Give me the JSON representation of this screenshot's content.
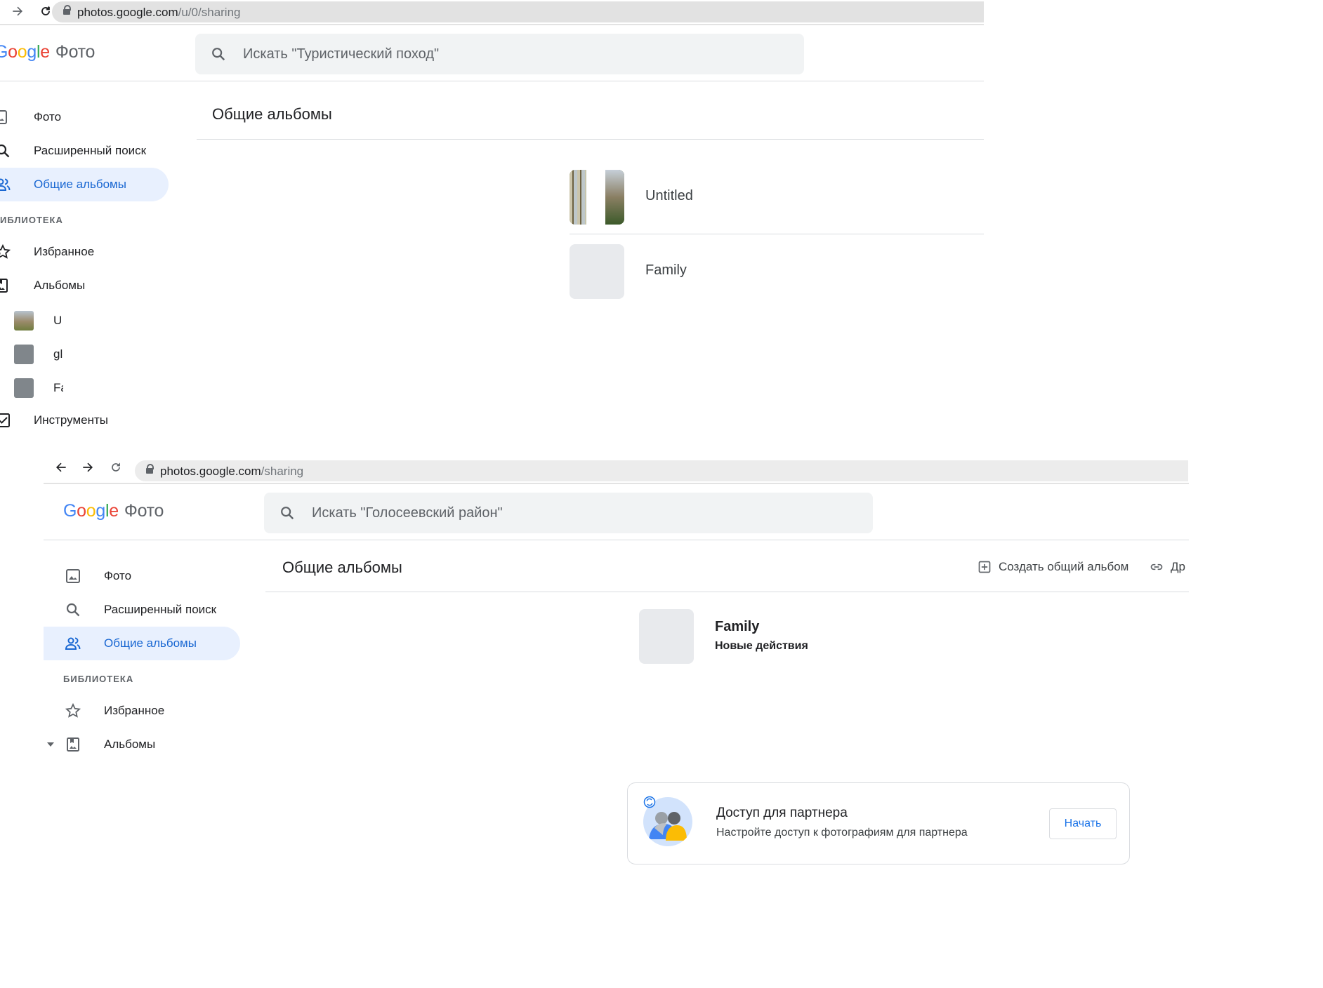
{
  "shot1": {
    "url_host": "photos.google.com",
    "url_path": "/u/0/sharing",
    "logo_text": "oogle",
    "logo_product": "Фото",
    "search_placeholder": "Искать \"Туристический поход\"",
    "nav": {
      "photos": "Фото",
      "explore": "Расширенный поиск",
      "sharing": "Общие альбомы",
      "library_label": "ИБЛИОТЕКА",
      "favorites": "Избранное",
      "albums": "Альбомы",
      "sub_albums": [
        "U",
        "gl",
        "Fa"
      ],
      "utilities": "Инструменты"
    },
    "page_title": "Общие альбомы",
    "albums": [
      {
        "title": "Untitled"
      },
      {
        "title": "Family"
      }
    ]
  },
  "shot2": {
    "url_host": "photos.google.com",
    "url_path": "/sharing",
    "logo_parts": [
      "G",
      "o",
      "o",
      "g",
      "l",
      "e"
    ],
    "logo_product": "Фото",
    "search_placeholder": "Искать \"Голосеевский район\"",
    "nav": {
      "photos": "Фото",
      "explore": "Расширенный поиск",
      "sharing": "Общие альбомы",
      "library_label": "БИБЛИОТЕКА",
      "favorites": "Избранное",
      "albums": "Альбомы"
    },
    "page_title": "Общие альбомы",
    "actions": {
      "create": "Создать общий альбом",
      "link": "Др"
    },
    "album": {
      "title": "Family",
      "subtitle": "Новые действия"
    },
    "partner": {
      "title": "Доступ для партнера",
      "description": "Настройте доступ к фотографиям для партнера",
      "button": "Начать"
    }
  },
  "colors": {
    "active_nav_bg": "#e8f0fe",
    "active_nav_text": "#1967d2",
    "accent": "#1a73e8"
  },
  "icons": [
    "back-icon",
    "forward-icon",
    "reload-icon",
    "lock-icon",
    "search-icon",
    "photo-icon",
    "sharing-icon",
    "star-icon",
    "album-icon",
    "checkbox-icon",
    "add-box-icon",
    "link-icon",
    "expand-arrow-icon"
  ]
}
